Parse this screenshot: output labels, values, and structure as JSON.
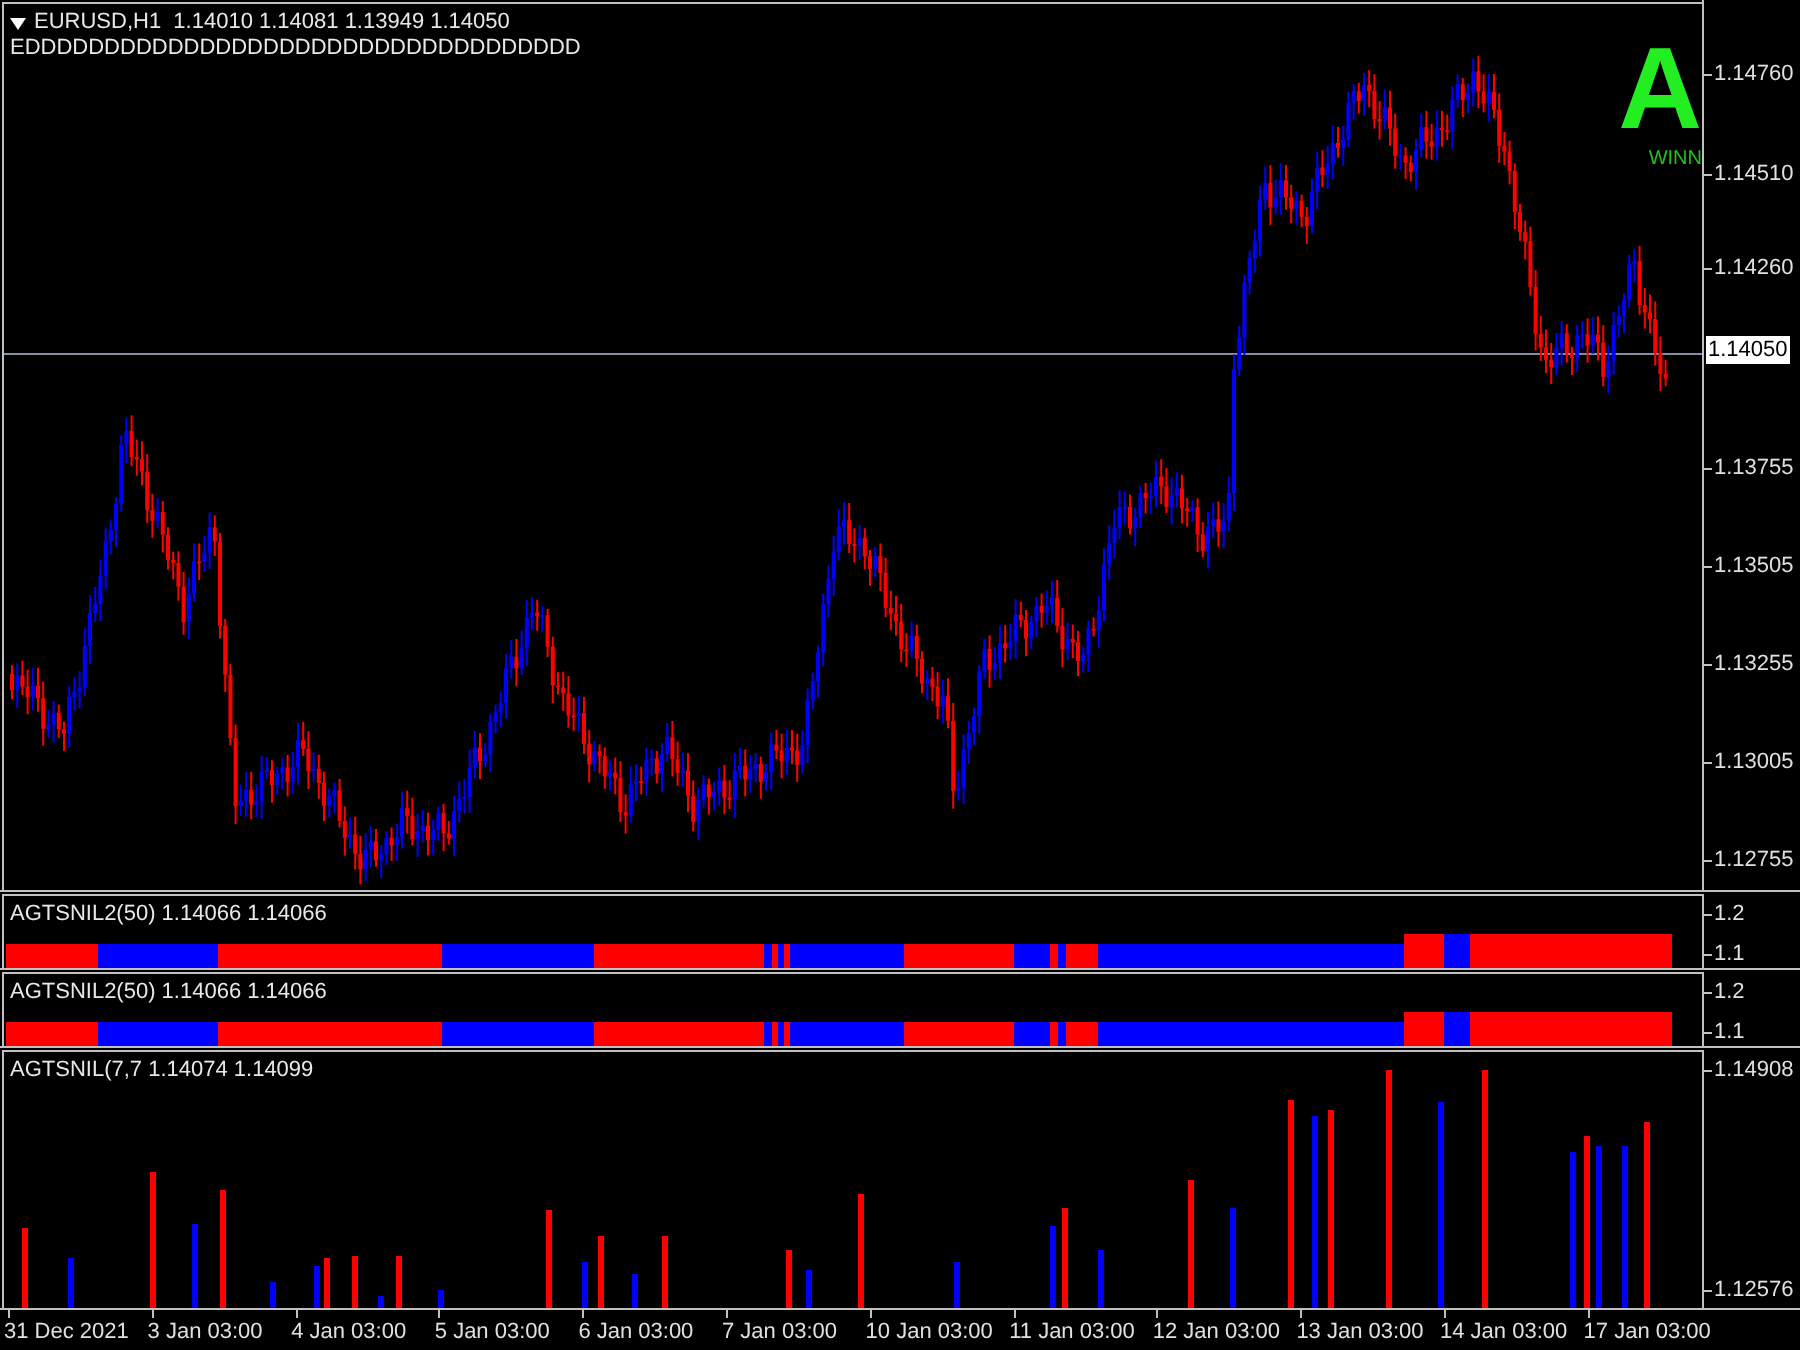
{
  "main_chart": {
    "header": "EURUSD,H1  1.14010 1.14081 1.13949 1.14050",
    "subtitle": "EDDDDDDDDDDDDDDDDDDDDDDDDDDDDDDDDDDD",
    "signal_letter": "A",
    "signal_caption": "WINN",
    "current_price": "1.14050",
    "price_ticks": [
      "1.14760",
      "1.14510",
      "1.14260",
      "1.13755",
      "1.13505",
      "1.13255",
      "1.13005",
      "1.12755"
    ]
  },
  "indicator_panes": [
    {
      "label": "AGTSNIL2(50) 1.14066 1.14066",
      "ticks": [
        "1.2",
        "1.1"
      ]
    },
    {
      "label": "AGTSNIL2(50) 1.14066 1.14066",
      "ticks": [
        "1.2",
        "1.1"
      ]
    }
  ],
  "histogram_pane": {
    "label": "AGTSNIL(7,7 1.14074 1.14099",
    "ticks": [
      "1.14908",
      "1.12576"
    ]
  },
  "time_axis": [
    "31 Dec 2021",
    "3 Jan 03:00",
    "4 Jan 03:00",
    "5 Jan 03:00",
    "6 Jan 03:00",
    "7 Jan 03:00",
    "10 Jan 03:00",
    "11 Jan 03:00",
    "12 Jan 03:00",
    "13 Jan 03:00",
    "14 Jan 03:00",
    "17 Jan 03:00"
  ]
}
